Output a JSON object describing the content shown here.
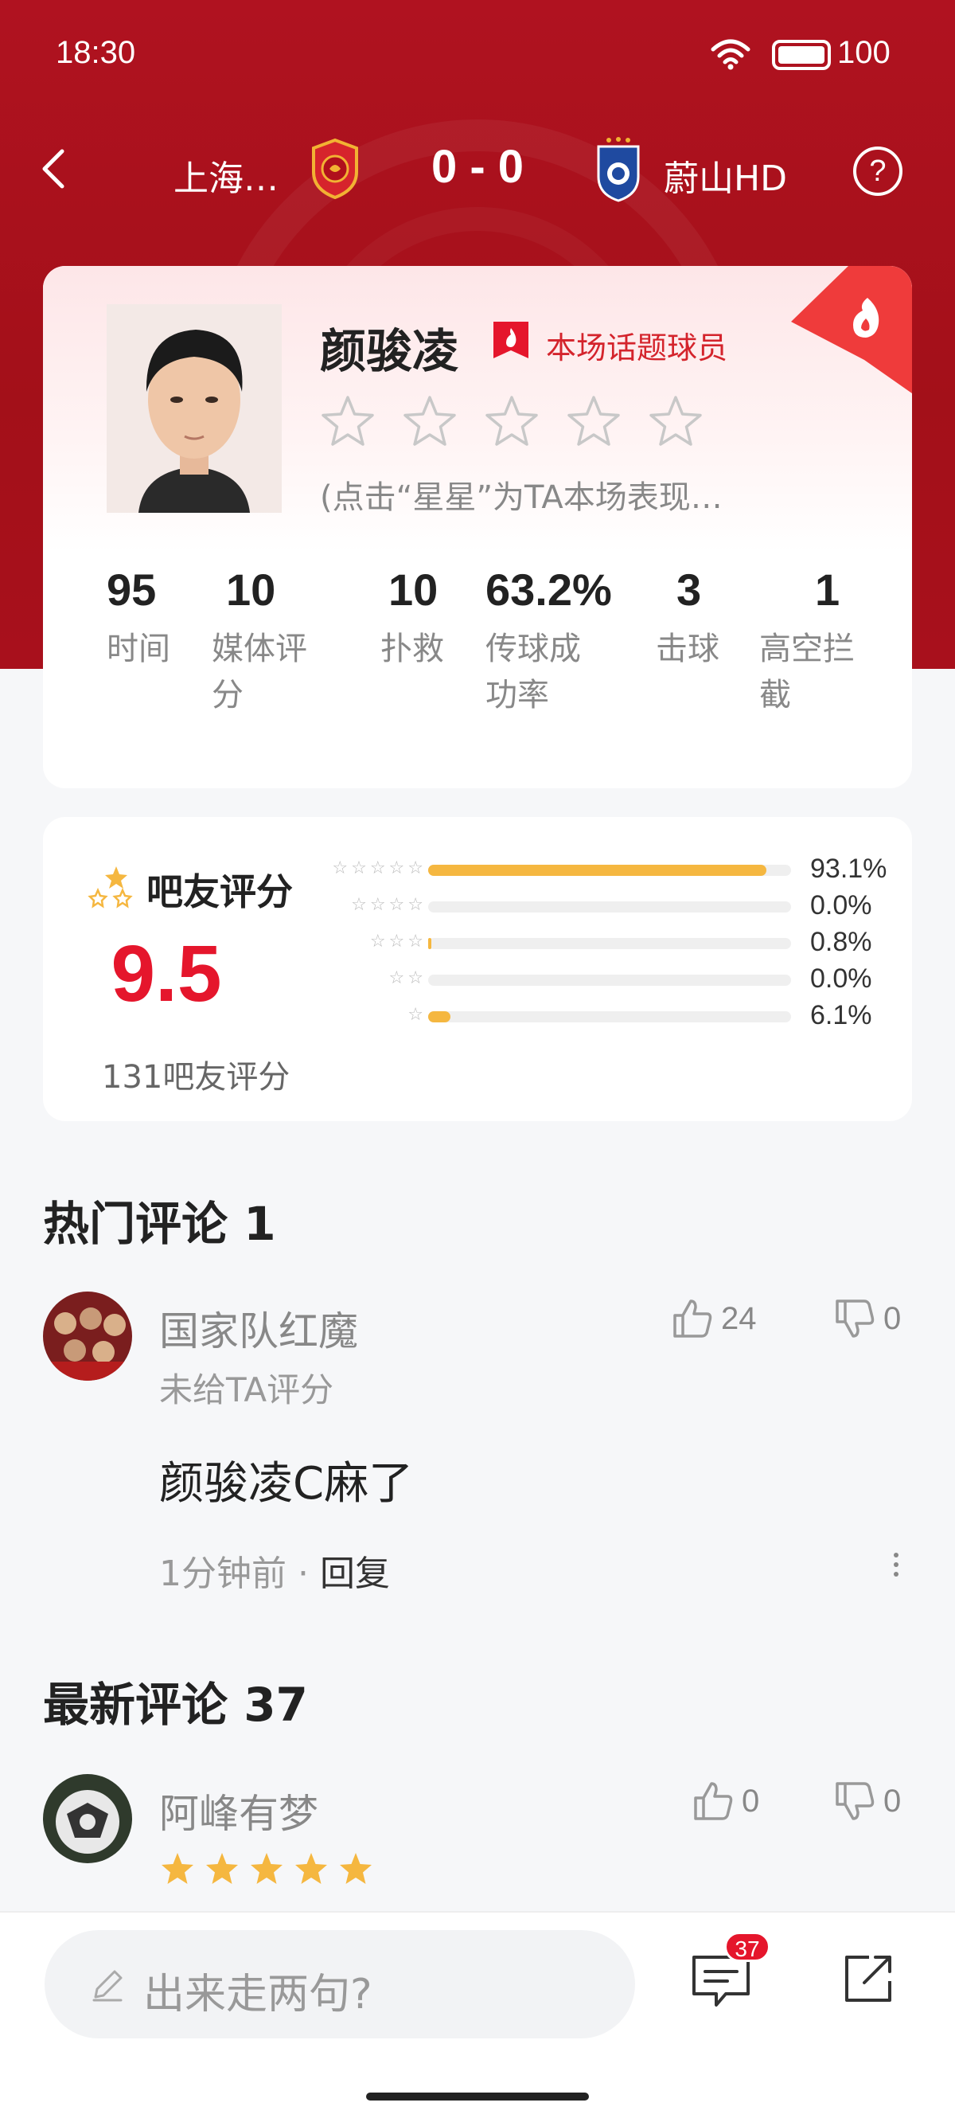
{
  "status_bar": {
    "time": "18:30",
    "battery": "100"
  },
  "match": {
    "home_team": "上海…",
    "score": "0 - 0",
    "away_team": "蔚山HD",
    "help": "?"
  },
  "player": {
    "name": "颜骏凌",
    "topic_label": "本场话题球员",
    "rate_hint": "(点击“星星”为TA本场表现…",
    "stats": [
      {
        "value": "95",
        "label": "时间"
      },
      {
        "value": "10",
        "label": "媒体评分"
      },
      {
        "value": "10",
        "label": "扑救"
      },
      {
        "value": "63.2%",
        "label": "传球成功率"
      },
      {
        "value": "3",
        "label": "击球"
      },
      {
        "value": "1",
        "label": "高空拦截"
      }
    ]
  },
  "fan_rating": {
    "title": "吧友评分",
    "score": "9.5",
    "count": "131吧友评分",
    "distribution": [
      {
        "stars": 5,
        "percent": "93.1%",
        "fraction": 0.931
      },
      {
        "stars": 4,
        "percent": "0.0%",
        "fraction": 0.0
      },
      {
        "stars": 3,
        "percent": "0.8%",
        "fraction": 0.008
      },
      {
        "stars": 2,
        "percent": "0.0%",
        "fraction": 0.0
      },
      {
        "stars": 1,
        "percent": "6.1%",
        "fraction": 0.061
      }
    ],
    "bar_color": "#f5b740"
  },
  "hot_comments": {
    "title": "热门评论 1",
    "items": [
      {
        "user": "国家队红魔",
        "sub": "未给TA评分",
        "likes": "24",
        "dislikes": "0",
        "text": "颜骏凌C麻了",
        "time": "1分钟前",
        "reply": "回复"
      }
    ]
  },
  "latest_comments": {
    "title": "最新评论 37",
    "items": [
      {
        "user": "阿峰有梦",
        "likes": "0",
        "dislikes": "0",
        "rating_stars": 5
      }
    ]
  },
  "bottom_bar": {
    "placeholder": "出来走两句?",
    "badge": "37"
  },
  "colors": {
    "accent": "#e5162c",
    "hero": "#a8101c",
    "star_gold": "#f5b740"
  }
}
